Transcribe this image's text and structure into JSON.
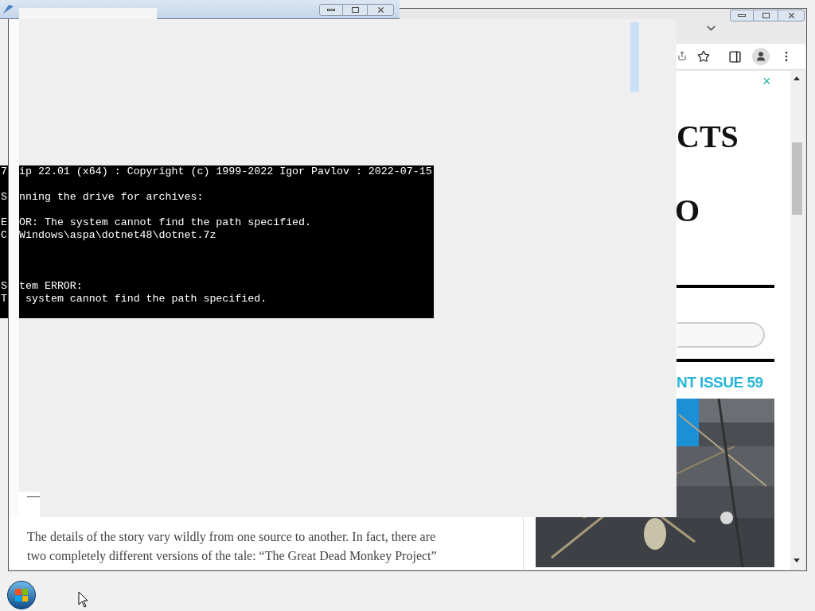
{
  "console": {
    "lines": [
      {
        "kind": "text",
        "start": "7",
        "rest": "ip 22.01 (x64) : Copyright (c) 1999-2022 Igor Pavlov : 2022-07-15"
      },
      {
        "kind": "gap"
      },
      {
        "kind": "text",
        "start": "S",
        "rest": "nning the drive for archives:"
      },
      {
        "kind": "gap"
      },
      {
        "kind": "text",
        "start": "E",
        "rest": "OR: The system cannot find the path specified."
      },
      {
        "kind": "text",
        "start": "C",
        "rest": "Windows\\aspa\\dotnet48\\dotnet.7z"
      },
      {
        "kind": "gap"
      },
      {
        "kind": "gap"
      },
      {
        "kind": "gap"
      },
      {
        "kind": "text",
        "start": "S",
        "rest": "tem ERROR:"
      },
      {
        "kind": "text",
        "start": "T",
        "rest": " system cannot find the path specified."
      }
    ]
  },
  "browser": {
    "article": {
      "dash": "—",
      "paragraph": [
        "The details of the story vary wildly from one source to another. In fact, there are",
        "two completely different versions of the tale: “The Great Dead Monkey Project”"
      ]
    },
    "sidebar": {
      "close": "×",
      "heading_1": "CTS",
      "heading_2": "O",
      "issue_heading": "NT ISSUE 59"
    }
  }
}
